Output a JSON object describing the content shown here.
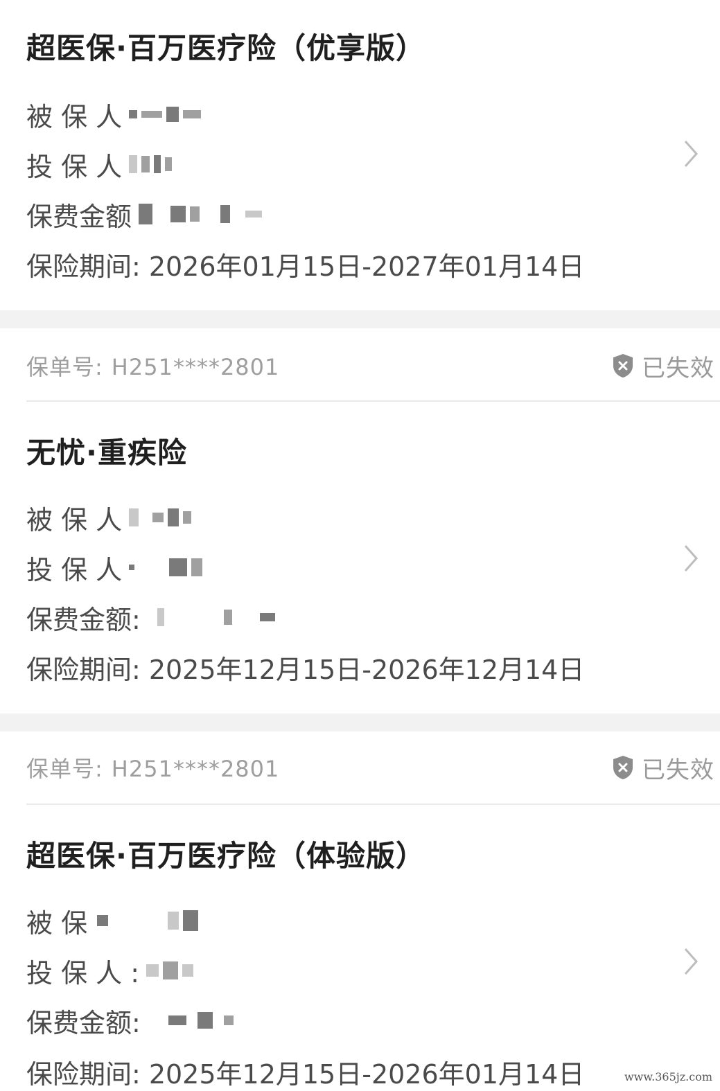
{
  "policies": [
    {
      "title": "超医保·百万医疗险（优享版）",
      "insured_label": "被 保 人",
      "holder_label": "投 保 人",
      "premium_label": "保费金额",
      "period_label": "保险期间:",
      "period_value": "2026年01月15日-2027年01月14日"
    },
    {
      "policy_no_label": "保单号:",
      "policy_no_value": "H251****2801",
      "status": "已失效",
      "title": "无忧·重疾险",
      "insured_label": "被 保 人",
      "holder_label": "投 保 人",
      "premium_label": "保费金额:",
      "period_label": "保险期间:",
      "period_value": "2025年12月15日-2026年12月14日"
    },
    {
      "policy_no_label": "保单号:",
      "policy_no_value": "H251****2801",
      "status": "已失效",
      "title": "超医保·百万医疗险（体验版）",
      "insured_label": "被 保",
      "holder_label": "投 保 人 :",
      "premium_label": "保费金额:",
      "period_label": "保险期间:",
      "period_value": "2025年12月15日-2026年01月14日"
    }
  ],
  "watermark": "www.365jz.com",
  "icons": {
    "status": "shield-x-icon",
    "chevron": "chevron-right-icon"
  },
  "colors": {
    "gap": "#f2f2f2",
    "muted_text": "#9e9e9e",
    "title_text": "#1f1f1f"
  }
}
